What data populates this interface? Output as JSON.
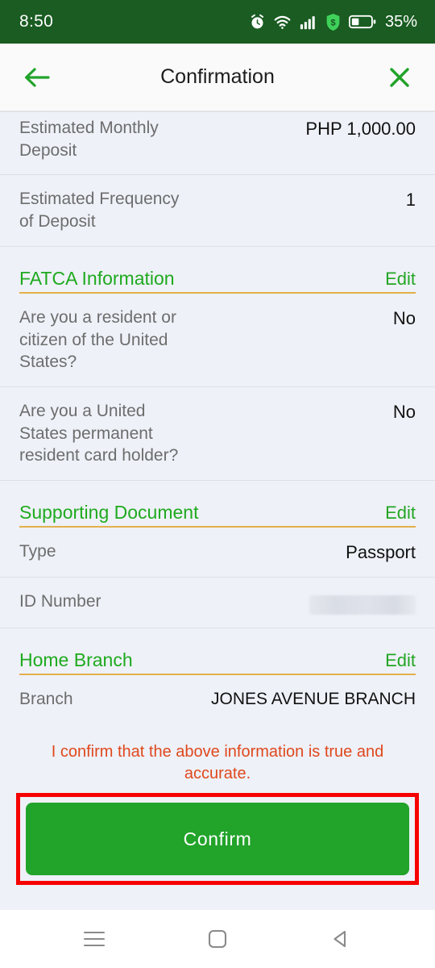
{
  "status_bar": {
    "time": "8:50",
    "battery_percent": "35%",
    "icons": [
      "alarm-icon",
      "wifi-icon",
      "signal-icon",
      "money-shield-icon",
      "battery-icon"
    ]
  },
  "app_bar": {
    "back_icon": "back-arrow-icon",
    "title": "Confirmation",
    "close_icon": "close-icon"
  },
  "rows": {
    "monthly_deposit": {
      "label": "Estimated Monthly Deposit",
      "value": "PHP 1,000.00"
    },
    "frequency": {
      "label": "Estimated Frequency of Deposit",
      "value": "1"
    },
    "fatca_resident": {
      "label": "Are you a resident or citizen of the United States?",
      "value": "No"
    },
    "fatca_green_card": {
      "label": "Are you a United States permanent resident card holder?",
      "value": "No"
    },
    "doc_type": {
      "label": "Type",
      "value": "Passport"
    },
    "id_number": {
      "label": "ID Number",
      "value": ""
    },
    "branch": {
      "label": "Branch",
      "value": "JONES AVENUE BRANCH"
    }
  },
  "sections": {
    "fatca": {
      "title": "FATCA Information",
      "edit_label": "Edit"
    },
    "supporting_document": {
      "title": "Supporting Document",
      "edit_label": "Edit"
    },
    "home_branch": {
      "title": "Home Branch",
      "edit_label": "Edit"
    }
  },
  "footer": {
    "note": "I confirm that the above information is true and accurate.",
    "confirm_label": "Confirm"
  },
  "nav_bar": {
    "recents_icon": "menu-icon",
    "home_icon": "home-square-icon",
    "back_icon": "back-triangle-icon"
  },
  "colors": {
    "status_bar_green": "#1a5c22",
    "brand_green": "#22a32a",
    "section_underline": "#e3b04b",
    "warning_orange": "#e0481d",
    "highlight_red": "#f70000",
    "content_bg": "#eef1f8"
  }
}
